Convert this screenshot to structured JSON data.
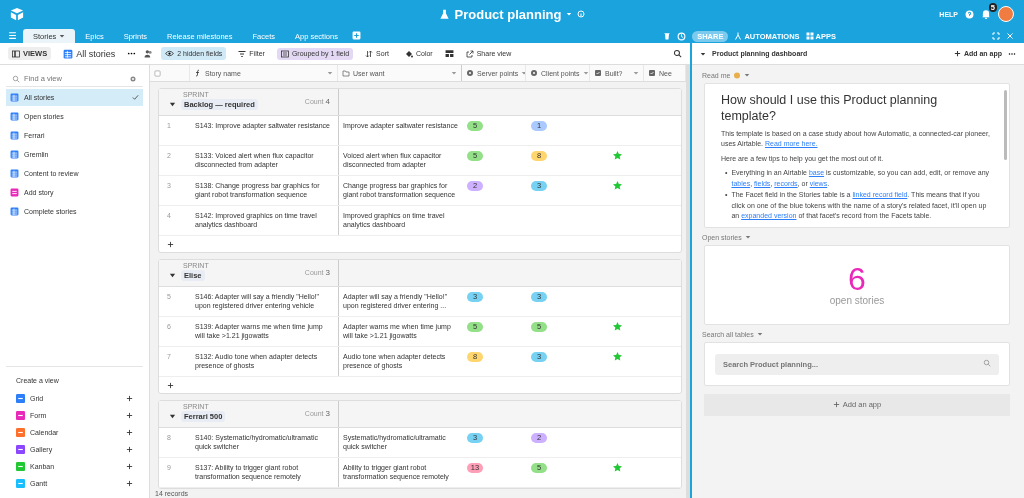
{
  "topbar": {
    "title": "Product planning",
    "help": "HELP",
    "notifications": "5"
  },
  "tabs": [
    {
      "label": "Stories",
      "selected": true
    },
    {
      "label": "Epics",
      "selected": false
    },
    {
      "label": "Sprints",
      "selected": false
    },
    {
      "label": "Release milestones",
      "selected": false
    },
    {
      "label": "Facets",
      "selected": false
    },
    {
      "label": "App sections",
      "selected": false
    }
  ],
  "tabbar_actions": {
    "share": "SHARE",
    "automations": "AUTOMATIONS",
    "apps": "APPS"
  },
  "viewbar": {
    "views": "VIEWS",
    "current_view": "All stories",
    "hidden_fields": "2 hidden fields",
    "filter": "Filter",
    "grouped": "Grouped by 1 field",
    "sort": "Sort",
    "color_button": "Color",
    "share_view": "Share view"
  },
  "sidebar": {
    "search": {
      "placeholder": "Find a view"
    },
    "views": [
      {
        "label": "All stories",
        "kind": "grid",
        "selected": true
      },
      {
        "label": "Open stories",
        "kind": "grid",
        "selected": false
      },
      {
        "label": "Ferrari",
        "kind": "grid",
        "selected": false
      },
      {
        "label": "Gremlin",
        "kind": "grid",
        "selected": false
      },
      {
        "label": "Content to review",
        "kind": "grid",
        "selected": false
      },
      {
        "label": "Add story",
        "kind": "form",
        "selected": false
      },
      {
        "label": "Complete stories",
        "kind": "grid",
        "selected": false
      }
    ],
    "create_title": "Create a view",
    "create_items": [
      {
        "label": "Grid",
        "color": "#2d7ff9"
      },
      {
        "label": "Form",
        "color": "#e929ba"
      },
      {
        "label": "Calendar",
        "color": "#ff6f2c"
      },
      {
        "label": "Gallery",
        "color": "#8b46ff"
      },
      {
        "label": "Kanban",
        "color": "#20c933"
      },
      {
        "label": "Gantt",
        "color": "#18bfff"
      }
    ]
  },
  "table": {
    "columns": [
      "Story name",
      "User want",
      "Server points",
      "Client points",
      "Built?",
      "Nee"
    ],
    "groups": [
      {
        "label": "SPRINT",
        "name": "Backlog — required",
        "count_label": "Count",
        "count": "4",
        "rows": [
          {
            "number": "1",
            "story": "S143: Improve adapter saltwater resistance",
            "want": "Improve adapter saltwater resistance",
            "server": {
              "value": "5",
              "color": "#93e088"
            },
            "client": {
              "value": "1",
              "color": "#a9c9ff"
            },
            "built": false
          },
          {
            "number": "2",
            "story": "S133: Voiced alert when flux capacitor disconnected from adapter",
            "want": "Voiced alert when flux capacitor disconnected from adapter",
            "server": {
              "value": "5",
              "color": "#93e088"
            },
            "client": {
              "value": "8",
              "color": "#ffd66e"
            },
            "built": true
          },
          {
            "number": "3",
            "story": "S138: Change progress bar graphics for giant robot transformation sequence",
            "want": "Change progress bar graphics for giant robot transformation sequence",
            "server": {
              "value": "2",
              "color": "#cdb0ff"
            },
            "client": {
              "value": "3",
              "color": "#77d1f3"
            },
            "built": true
          },
          {
            "number": "4",
            "story": "S142: Improved graphics on time travel analytics dashboard",
            "want": "Improved graphics on time travel analytics dashboard",
            "built": false
          }
        ]
      },
      {
        "label": "SPRINT",
        "name": "Elise",
        "count_label": "Count",
        "count": "3",
        "rows": [
          {
            "number": "5",
            "story": "S146: Adapter will say a friendly \"Hello!\" upon registered driver entering vehicle",
            "want": "Adapter will say a friendly \"Hello!\" upon registered driver entering ...",
            "server": {
              "value": "3",
              "color": "#77d1f3"
            },
            "client": {
              "value": "3",
              "color": "#77d1f3"
            },
            "built": false
          },
          {
            "number": "6",
            "story": "S139: Adapter warns me when time jump will take >1.21 jigowatts",
            "want": "Adapter warns me when time jump will take >1.21 jigowatts",
            "server": {
              "value": "5",
              "color": "#93e088"
            },
            "client": {
              "value": "5",
              "color": "#93e088"
            },
            "built": true
          },
          {
            "number": "7",
            "story": "S132: Audio tone when adapter detects presence of ghosts",
            "want": "Audio tone when adapter detects presence of ghosts",
            "server": {
              "value": "8",
              "color": "#ffd66e"
            },
            "client": {
              "value": "3",
              "color": "#77d1f3"
            },
            "built": true
          }
        ]
      },
      {
        "label": "SPRINT",
        "name": "Ferrari 500",
        "count_label": "Count",
        "count": "3",
        "rows": [
          {
            "number": "8",
            "story": "S140: Systematic/hydromatic/ultramatic quick switcher",
            "want": "Systematic/hydromatic/ultramatic quick switcher",
            "server": {
              "value": "3",
              "color": "#77d1f3"
            },
            "client": {
              "value": "2",
              "color": "#cdb0ff"
            },
            "built": false
          },
          {
            "number": "9",
            "story": "S137: Ability to trigger giant robot transformation sequence remotely",
            "want": "Ability to trigger giant robot transformation sequence remotely",
            "server": {
              "value": "13",
              "color": "#ff9eb7"
            },
            "client": {
              "value": "5",
              "color": "#93e088"
            },
            "built": true
          }
        ]
      }
    ],
    "footer": "14 records"
  },
  "dashboard": {
    "title": "Product planning dashboard",
    "add_app": "Add an app",
    "readme": {
      "label": "Read me",
      "heading": "How should I use this Product planning template?",
      "paragraphs": [
        [
          {
            "text": "This template is based on a case study about how Automatic, a connected-car pioneer, uses Airtable. "
          },
          {
            "text": "Read more here.",
            "link": true
          }
        ],
        [
          {
            "text": "Here are a few tips to help you get the most out of it."
          }
        ]
      ],
      "bullet_marker": "•",
      "bullets": [
        [
          {
            "text": "Everything in an Airtable "
          },
          {
            "text": "base",
            "link": true
          },
          {
            "text": " is customizable, so you can add, edit, or remove any "
          },
          {
            "text": "tables",
            "link": true
          },
          {
            "text": ", "
          },
          {
            "text": "fields",
            "link": true
          },
          {
            "text": ", "
          },
          {
            "text": "records",
            "link": true
          },
          {
            "text": ", or "
          },
          {
            "text": "views",
            "link": true
          },
          {
            "text": "."
          }
        ],
        [
          {
            "text": "The Facet field in the Stories table is a "
          },
          {
            "text": "linked record field",
            "link": true
          },
          {
            "text": ". This means that if you click on one of the blue tokens with the name of a story's related facet, it'll open up an "
          },
          {
            "text": "expanded version",
            "link": true
          },
          {
            "text": " of that facet's record from the Facets table."
          }
        ]
      ]
    },
    "open_stories": {
      "label": "Open stories",
      "number": "6",
      "caption": "open stories"
    },
    "search": {
      "label": "Search all tables",
      "placeholder": "Search Product planning..."
    },
    "add_app_button": "Add an app"
  }
}
